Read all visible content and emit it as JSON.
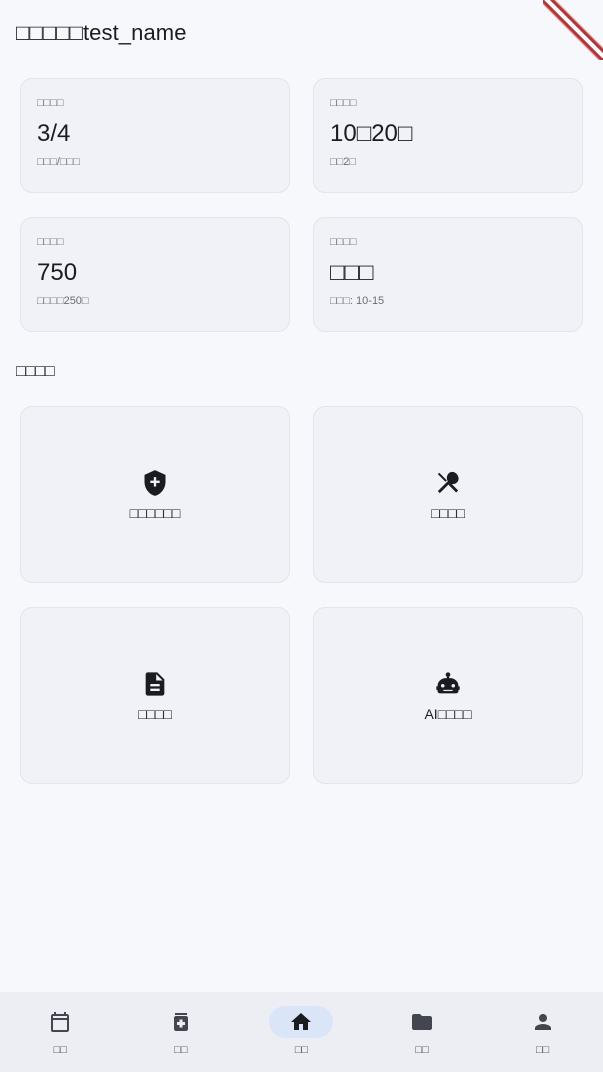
{
  "app": {
    "title": "□□□□□test_name"
  },
  "stats": [
    {
      "label": "□□□□",
      "value": "3/4",
      "sub": "□□□/□□□"
    },
    {
      "label": "□□□□",
      "value": "10□20□",
      "sub": "□□2□"
    },
    {
      "label": "□□□□",
      "value": "750",
      "sub": "□□□□250□"
    },
    {
      "label": "□□□□",
      "value": "□□□",
      "sub": "□□□: 10-15"
    }
  ],
  "actions_section": {
    "title": "□□□□",
    "items": [
      {
        "label": "□□□□□□",
        "icon": "shield-plus-icon"
      },
      {
        "label": "□□□□",
        "icon": "restaurant-icon"
      },
      {
        "label": "□□□□",
        "icon": "document-icon"
      },
      {
        "label": "AI□□□□",
        "icon": "robot-icon"
      }
    ]
  },
  "bottom_nav": {
    "active_index": 2,
    "items": [
      {
        "label": "□□",
        "icon": "calendar-icon"
      },
      {
        "label": "□□",
        "icon": "medication-icon"
      },
      {
        "label": "□□",
        "icon": "home-icon"
      },
      {
        "label": "□□",
        "icon": "folder-icon"
      },
      {
        "label": "□□",
        "icon": "person-icon"
      }
    ]
  },
  "colors": {
    "background": "#f7f8fc",
    "card": "#f1f2f8",
    "nav_background": "#eceef4",
    "nav_active_pill": "#dbe5f8",
    "debug_banner": "#b1363a"
  }
}
